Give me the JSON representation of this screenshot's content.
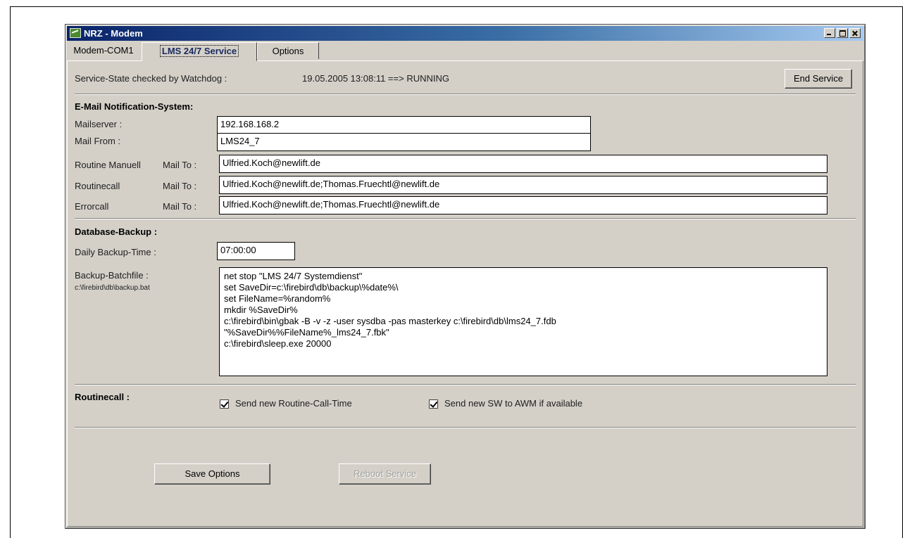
{
  "window": {
    "title": "NRZ - Modem"
  },
  "tabs": [
    {
      "label": "Modem-COM1"
    },
    {
      "label": "LMS 24/7 Service"
    },
    {
      "label": "Options"
    }
  ],
  "service": {
    "state_label": "Service-State checked by Watchdog :",
    "state_value": "19.05.2005 13:08:11 ==> RUNNING",
    "end_button": "End Service"
  },
  "email": {
    "header": "E-Mail Notification-System:",
    "mailserver_label": "Mailserver :",
    "mailserver_value": "192.168.168.2",
    "mailfrom_label": "Mail From :",
    "mailfrom_value": "LMS24_7",
    "routine_manuell_label": "Routine Manuell",
    "routinecall_label": "Routinecall",
    "errorcall_label": "Errorcall",
    "mail_to_label": "Mail To :",
    "routine_manuell_value": "Ulfried.Koch@newlift.de",
    "routinecall_value": "Ulfried.Koch@newlift.de;Thomas.Fruechtl@newlift.de",
    "errorcall_value": "Ulfried.Koch@newlift.de;Thomas.Fruechtl@newlift.de"
  },
  "backup": {
    "header": "Database-Backup :",
    "time_label": "Daily Backup-Time :",
    "time_value": "07:00:00",
    "batch_label": "Backup-Batchfile   :",
    "batch_path": "c:\\firebird\\db\\backup.bat",
    "batch_lines": [
      "net stop \"LMS 24/7 Systemdienst\"",
      "set SaveDir=c:\\firebird\\db\\backup\\%date%\\",
      "set FileName=%random%",
      "mkdir %SaveDir%",
      "c:\\firebird\\bin\\gbak -B -v -z -user sysdba -pas masterkey c:\\firebird\\db\\lms24_7.fdb",
      "\"%SaveDir%%FileName%_lms24_7.fbk\"",
      "c:\\firebird\\sleep.exe 20000"
    ]
  },
  "routinecall": {
    "header": "Routinecall :",
    "option1": "Send new Routine-Call-Time",
    "option1_checked": true,
    "option2": "Send new SW to AWM if available",
    "option2_checked": true
  },
  "buttons": {
    "save": "Save Options",
    "reboot": "Reboot Service"
  }
}
